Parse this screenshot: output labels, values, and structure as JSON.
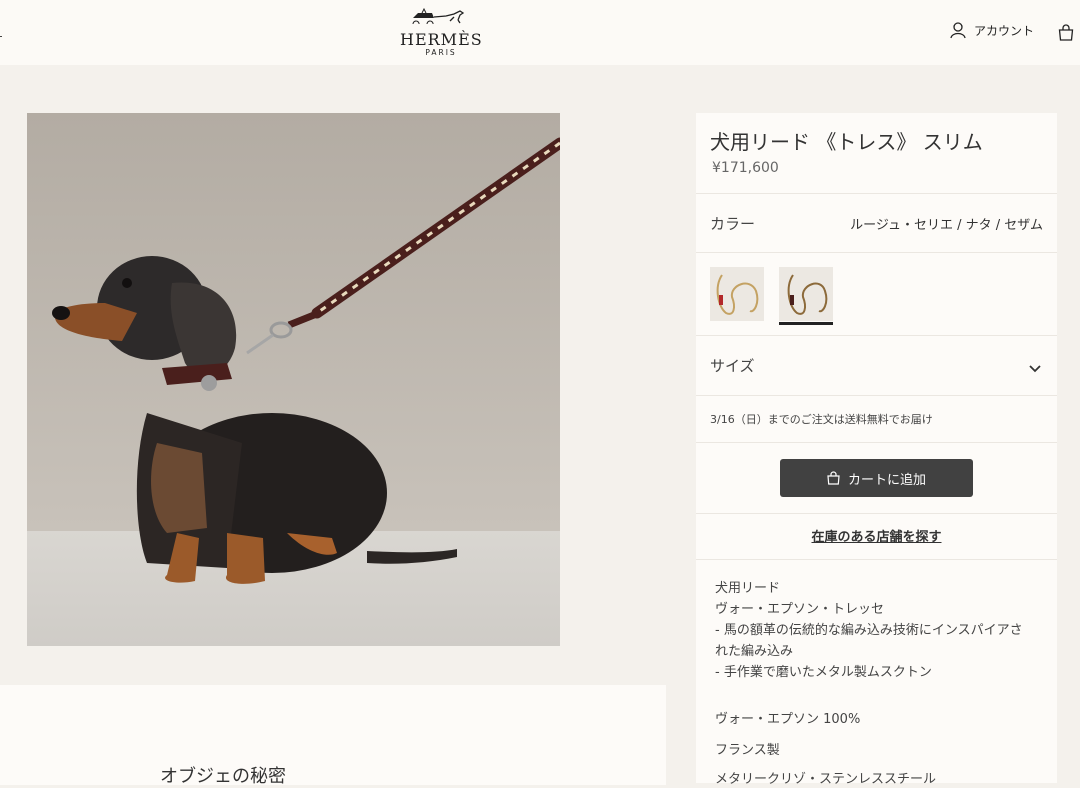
{
  "header": {
    "brand": "HERMÈS",
    "brand_sub": "PARIS",
    "account_label": "アカウント",
    "icons": [
      "person-icon",
      "shopping-bag-icon",
      "carriage-logo"
    ]
  },
  "product": {
    "title": "犬用リード 《トレス》 スリム",
    "price": "¥171,600",
    "color_label": "カラー",
    "color_value": "ルージュ・セリエ / ナタ / セザム",
    "size_label": "サイズ",
    "delivery_note": "3/16（日）までのご注文は送料無料でお届け",
    "add_to_cart_label": "カートに追加",
    "find_store_label": "在庫のある店舗を探す",
    "description_lines": [
      "犬用リード",
      "ヴォー・エプソン・トレッセ",
      "- 馬の額革の伝統的な編み込み技術にインスパイアさ",
      "れた編み込み",
      "- 手作業で磨いたメタル製ムスクトン"
    ],
    "material": "ヴォー・エプソン 100%",
    "origin": "フランス製",
    "partial_line": "メタリークリゾ・ステンレススチール"
  },
  "lower": {
    "title": "オブジェの秘密"
  },
  "colors": {
    "page_bg": "#f4f1ec",
    "panel_bg": "#fdfbf8",
    "button_bg": "#414141",
    "leash_brown": "#4a1f1c"
  }
}
